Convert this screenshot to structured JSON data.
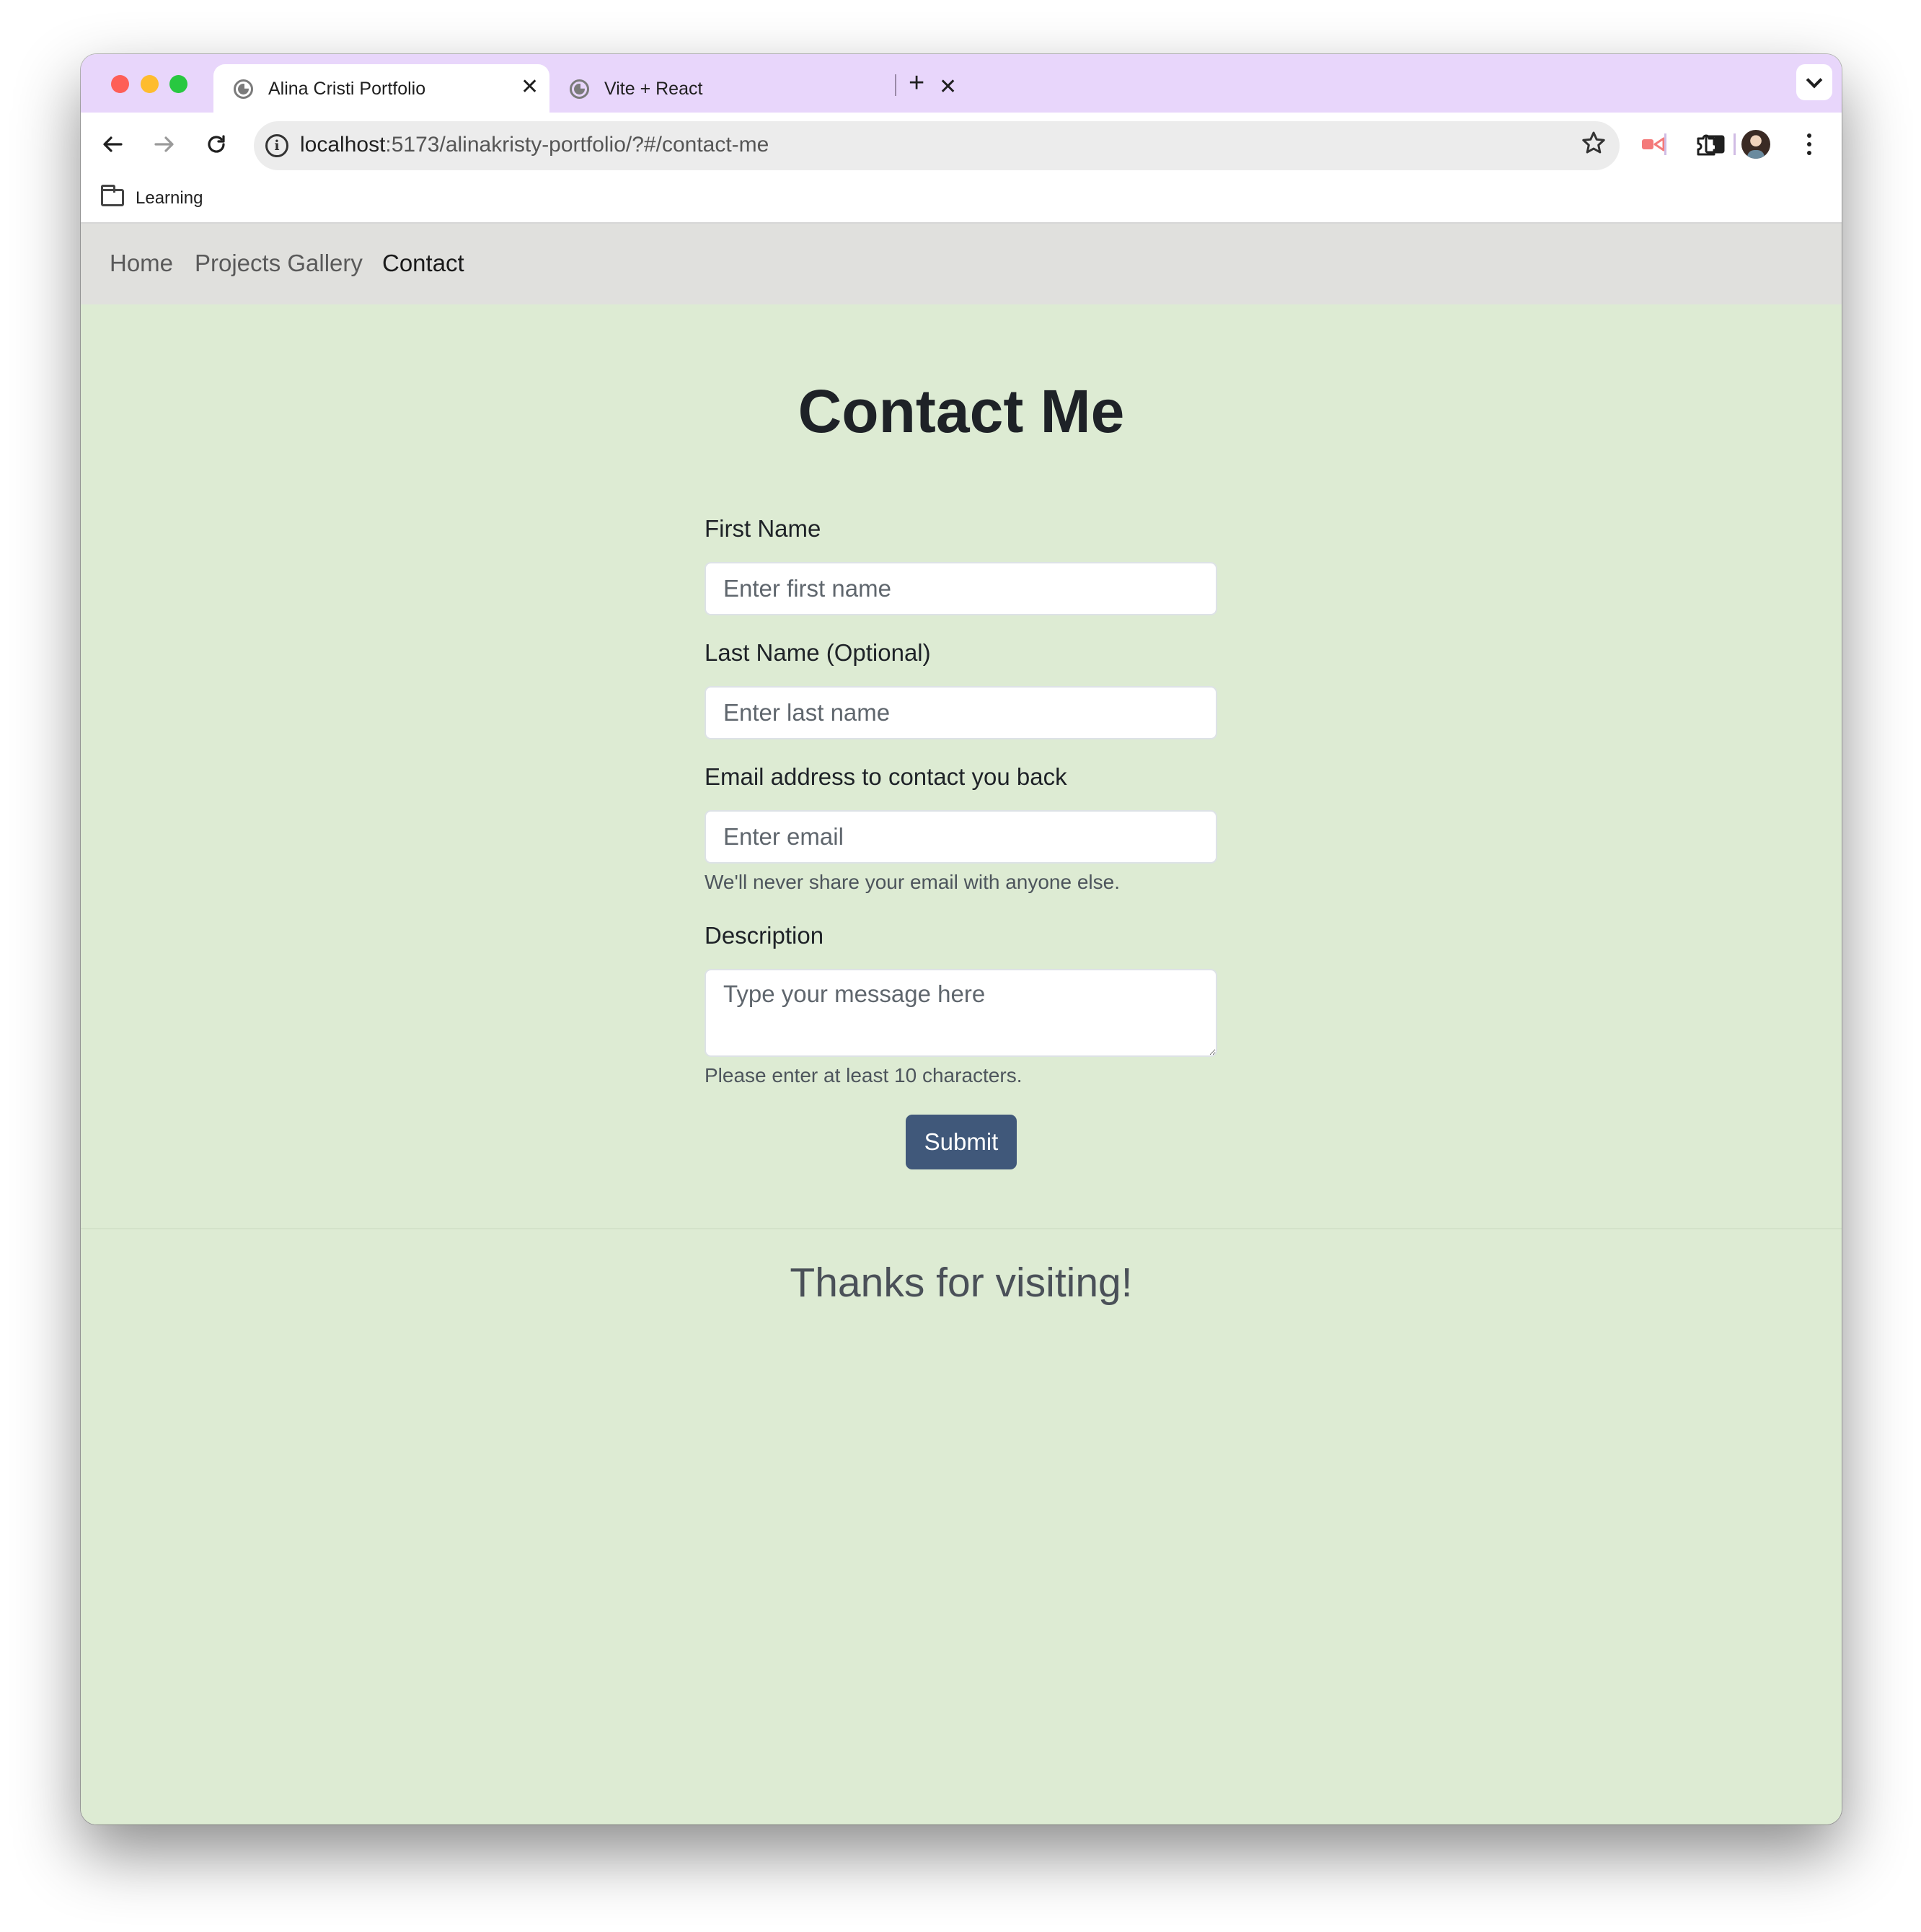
{
  "browser": {
    "tabs": [
      {
        "title": "Alina Cristi Portfolio",
        "active": true
      },
      {
        "title": "Vite + React",
        "active": false
      }
    ],
    "new_tab_symbol": "+",
    "close_symbol": "✕",
    "url_host": "localhost",
    "url_path": ":5173/alinakristy-portfolio/?#/contact-me",
    "bookmarks": [
      {
        "label": "Learning"
      }
    ],
    "accent_colors": {
      "tabstrip": "#e8d6fb",
      "omnibox": "#ececec"
    }
  },
  "nav": {
    "links": [
      {
        "label": "Home",
        "active": false
      },
      {
        "label": "Projects Gallery",
        "active": false
      },
      {
        "label": "Contact",
        "active": true
      }
    ]
  },
  "contact": {
    "title": "Contact Me",
    "fields": {
      "first_name": {
        "label": "First Name",
        "placeholder": "Enter first name",
        "value": ""
      },
      "last_name": {
        "label": "Last Name (Optional)",
        "placeholder": "Enter last name",
        "value": ""
      },
      "email": {
        "label": "Email address to contact you back",
        "placeholder": "Enter email",
        "value": "",
        "help": "We'll never share your email with anyone else."
      },
      "description": {
        "label": "Description",
        "placeholder": "Type your message here",
        "value": "",
        "help": "Please enter at least 10 characters."
      }
    },
    "submit_label": "Submit"
  },
  "footer": {
    "text": "Thanks for visiting!"
  },
  "colors": {
    "page_background": "#ddebd3",
    "navbar_background": "#e0e0dd",
    "submit_button": "#40587a"
  }
}
